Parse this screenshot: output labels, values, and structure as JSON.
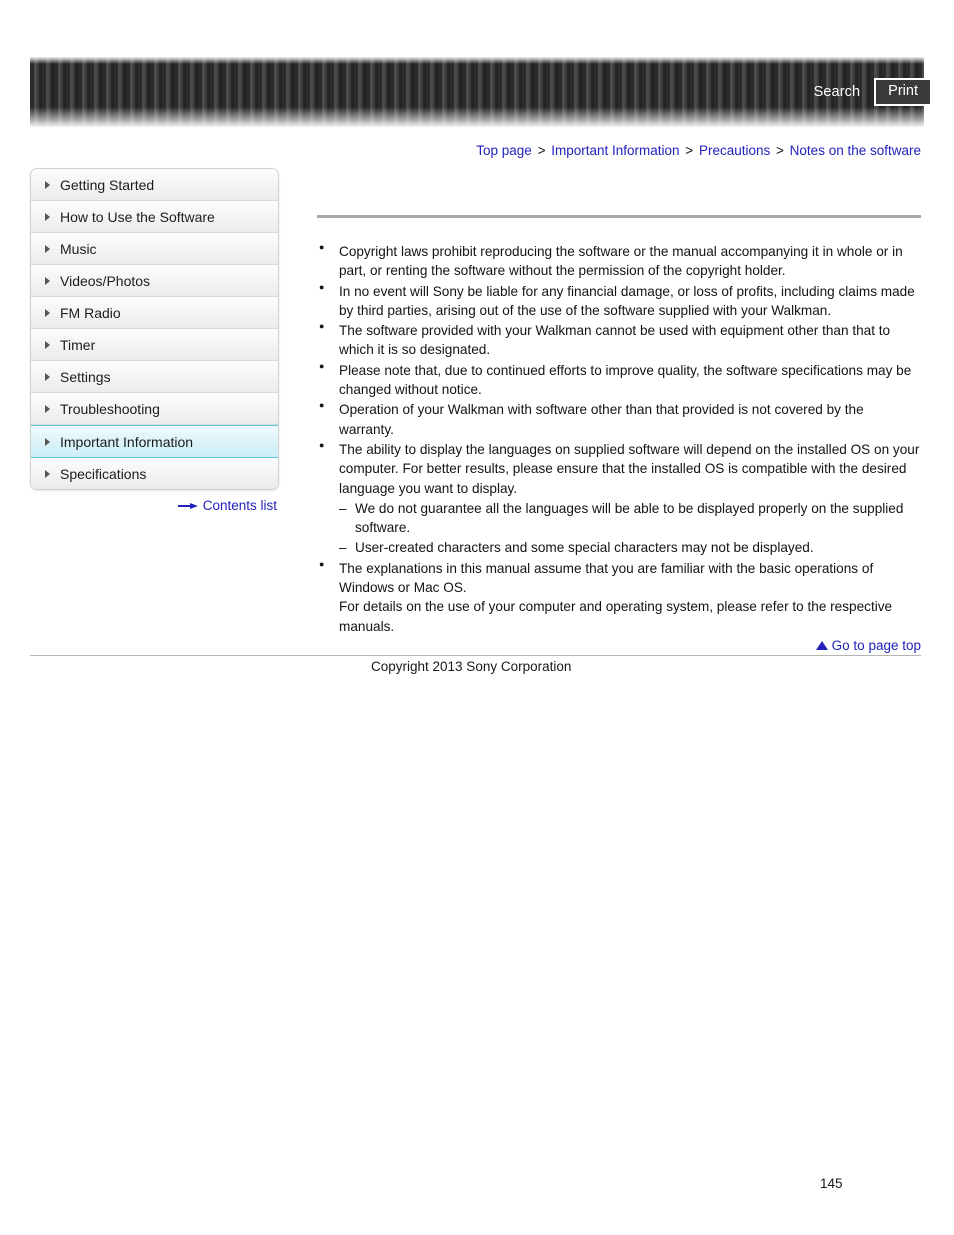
{
  "header": {
    "search_label": "Search",
    "print_label": "Print"
  },
  "breadcrumb": {
    "items": [
      {
        "label": "Top page"
      },
      {
        "label": "Important Information"
      },
      {
        "label": "Precautions"
      },
      {
        "label": "Notes on the software"
      }
    ],
    "separator": ">"
  },
  "sidebar": {
    "items": [
      {
        "label": "Getting Started",
        "active": false
      },
      {
        "label": "How to Use the Software",
        "active": false
      },
      {
        "label": "Music",
        "active": false
      },
      {
        "label": "Videos/Photos",
        "active": false
      },
      {
        "label": "FM Radio",
        "active": false
      },
      {
        "label": "Timer",
        "active": false
      },
      {
        "label": "Settings",
        "active": false
      },
      {
        "label": "Troubleshooting",
        "active": false
      },
      {
        "label": "Important Information",
        "active": true
      },
      {
        "label": "Specifications",
        "active": false
      }
    ],
    "contents_list_label": "Contents list"
  },
  "main": {
    "bullets": [
      {
        "text": "Copyright laws prohibit reproducing the software or the manual accompanying it in whole or in part, or renting the software without the permission of the copyright holder."
      },
      {
        "text": "In no event will Sony be liable for any financial damage, or loss of profits, including claims made by third parties, arising out of the use of the software supplied with your Walkman."
      },
      {
        "text": "The software provided with your Walkman cannot be used with equipment other than that to which it is so designated."
      },
      {
        "text": "Please note that, due to continued efforts to improve quality, the software specifications may be changed without notice."
      },
      {
        "text": "Operation of your Walkman with software other than that provided is not covered by the warranty."
      },
      {
        "text": "The ability to display the languages on supplied software will depend on the installed OS on your computer. For better results, please ensure that the installed OS is compatible with the desired language you want to display.",
        "sub": [
          "We do not guarantee all the languages will be able to be displayed properly on the supplied software.",
          "User-created characters and some special characters may not be displayed."
        ]
      },
      {
        "text": "The explanations in this manual assume that you are familiar with the basic operations of Windows or Mac OS.\nFor details on the use of your computer and operating system, please refer to the respective manuals."
      }
    ]
  },
  "footer": {
    "page_top_label": "Go to page top",
    "copyright": "Copyright 2013 Sony Corporation",
    "page_number": "145"
  },
  "colors": {
    "link_blue": "#2222bb",
    "active_cyan": "#5fc8e0",
    "rule_gray": "#a8a8a8"
  }
}
